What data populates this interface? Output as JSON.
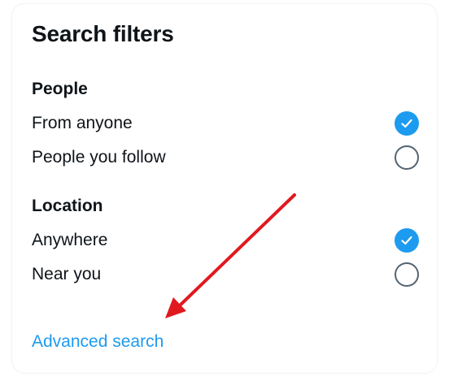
{
  "panel": {
    "title": "Search filters"
  },
  "people": {
    "heading": "People",
    "options": [
      {
        "label": "From anyone",
        "checked": true
      },
      {
        "label": "People you follow",
        "checked": false
      }
    ]
  },
  "location": {
    "heading": "Location",
    "options": [
      {
        "label": "Anywhere",
        "checked": true
      },
      {
        "label": "Near you",
        "checked": false
      }
    ]
  },
  "links": {
    "advanced_search": "Advanced search"
  },
  "colors": {
    "accent": "#1d9bf0",
    "text": "#0f1419",
    "radio_border": "#536471",
    "annotation_arrow": "#e0191f"
  },
  "icons": {
    "checked": "check-icon",
    "annotation": "red-arrow-annotation-icon"
  }
}
